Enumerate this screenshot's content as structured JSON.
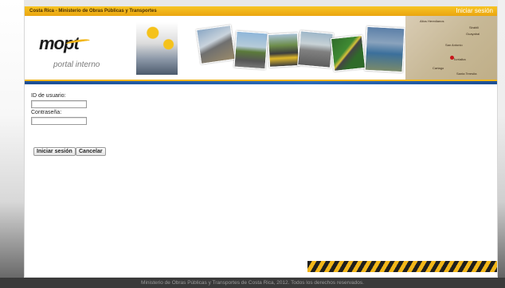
{
  "header": {
    "site_title": "Costa Rica - Ministerio de Obras Públicas y Transportes",
    "login_link": "Iniciar sesión"
  },
  "banner": {
    "logo_text": "mopt",
    "subtitle": "portal interno",
    "map_labels": [
      "Altos Heredianos",
      "Sirabili",
      "Guayabal",
      "San Antonio",
      "Turrialba",
      "Cartago",
      "Santa Teresita"
    ]
  },
  "form": {
    "user_label": "ID de usuario:",
    "user_value": "",
    "password_label": "Contraseña:",
    "password_value": "",
    "login_button": "Iniciar sesión",
    "cancel_button": "Cancelar"
  },
  "footer": {
    "text": "Ministerio de Obras Públicas y Transportes de Costa Rica, 2012. Todos los derechos reservados."
  },
  "colors": {
    "top_bar": "#f2b619",
    "blue_bar": "#1d4f94",
    "footer_bg": "#3a3a3a"
  }
}
